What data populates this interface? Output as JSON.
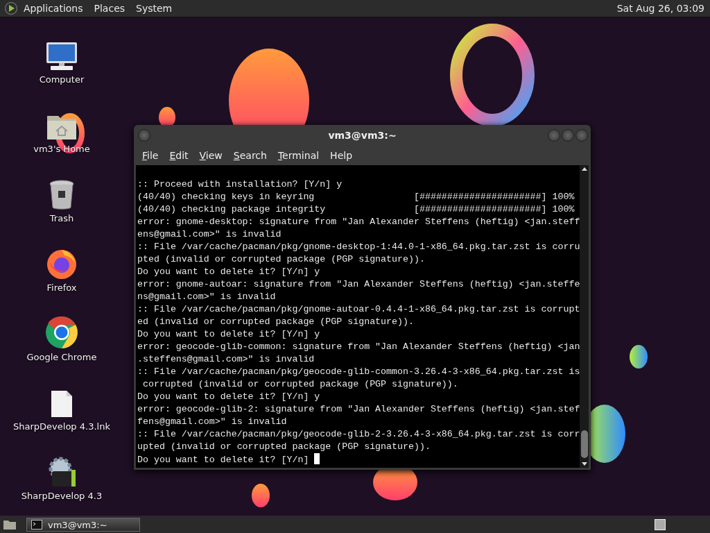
{
  "top_panel": {
    "menus": [
      "Applications",
      "Places",
      "System"
    ],
    "clock": "Sat Aug 26, 03:09"
  },
  "desktop_icons": [
    {
      "kind": "computer",
      "label": "Computer"
    },
    {
      "kind": "home",
      "label": "vm3's Home"
    },
    {
      "kind": "trash",
      "label": "Trash"
    },
    {
      "kind": "firefox",
      "label": "Firefox"
    },
    {
      "kind": "chrome",
      "label": "Google Chrome"
    },
    {
      "kind": "file",
      "label": "SharpDevelop 4.3.lnk"
    },
    {
      "kind": "sharpdevelop",
      "label": "SharpDevelop 4.3"
    }
  ],
  "window": {
    "title": "vm3@vm3:~",
    "menu": [
      {
        "label": "File",
        "mnemonic": true
      },
      {
        "label": "Edit",
        "mnemonic": true
      },
      {
        "label": "View",
        "mnemonic": true
      },
      {
        "label": "Search",
        "mnemonic": true
      },
      {
        "label": "Terminal",
        "mnemonic": true
      },
      {
        "label": "Help",
        "mnemonic": false
      }
    ],
    "lines": [
      ":: Proceed with installation? [Y/n] y",
      "(40/40) checking keys in keyring                  [######################] 100%",
      "(40/40) checking package integrity                [######################] 100%",
      "error: gnome-desktop: signature from \"Jan Alexander Steffens (heftig) <jan.steff",
      "ens@gmail.com>\" is invalid",
      ":: File /var/cache/pacman/pkg/gnome-desktop-1:44.0-1-x86_64.pkg.tar.zst is corru",
      "pted (invalid or corrupted package (PGP signature)).",
      "Do you want to delete it? [Y/n] y",
      "error: gnome-autoar: signature from \"Jan Alexander Steffens (heftig) <jan.steffe",
      "ns@gmail.com>\" is invalid",
      ":: File /var/cache/pacman/pkg/gnome-autoar-0.4.4-1-x86_64.pkg.tar.zst is corrupt",
      "ed (invalid or corrupted package (PGP signature)).",
      "Do you want to delete it? [Y/n] y",
      "error: geocode-glib-common: signature from \"Jan Alexander Steffens (heftig) <jan",
      ".steffens@gmail.com>\" is invalid",
      ":: File /var/cache/pacman/pkg/geocode-glib-common-3.26.4-3-x86_64.pkg.tar.zst is",
      " corrupted (invalid or corrupted package (PGP signature)).",
      "Do you want to delete it? [Y/n] y",
      "error: geocode-glib-2: signature from \"Jan Alexander Steffens (heftig) <jan.stef",
      "fens@gmail.com>\" is invalid",
      ":: File /var/cache/pacman/pkg/geocode-glib-2-3.26.4-3-x86_64.pkg.tar.zst is corr",
      "upted (invalid or corrupted package (PGP signature)).",
      "Do you want to delete it? [Y/n] "
    ],
    "cursor_visible": true
  },
  "taskbar": {
    "tasks": [
      {
        "label": "vm3@vm3:~",
        "selected": true
      }
    ]
  }
}
